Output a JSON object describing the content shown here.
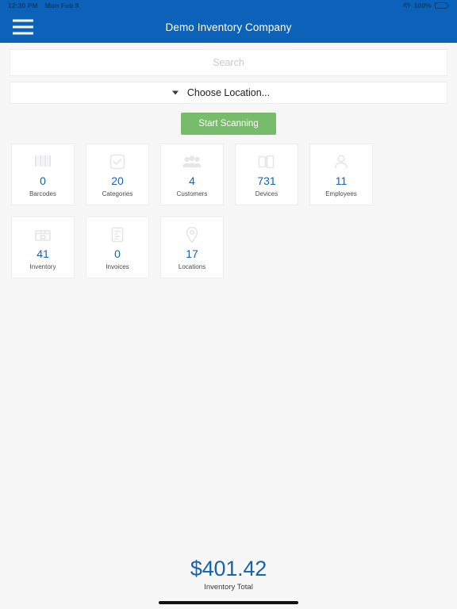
{
  "status_bar": {
    "time": "12:30 PM",
    "date": "Mon Feb 8",
    "battery_percent": "100%",
    "wifi_icon": "wifi-icon",
    "battery_icon": "battery-icon"
  },
  "navbar": {
    "menu_icon": "hamburger-menu-icon",
    "title": "Demo Inventory Company"
  },
  "search": {
    "value": "",
    "placeholder": "Search"
  },
  "location": {
    "label": "Choose Location...",
    "caret_icon": "chevron-down-icon"
  },
  "scan": {
    "label": "Start Scanning",
    "color": "#77bc6a"
  },
  "cards": [
    {
      "value": "0",
      "label": "Barcodes",
      "icon": "barcode-icon"
    },
    {
      "value": "20",
      "label": "Categories",
      "icon": "checkbox-icon"
    },
    {
      "value": "4",
      "label": "Customers",
      "icon": "customers-icon"
    },
    {
      "value": "731",
      "label": "Devices",
      "icon": "devices-icon"
    },
    {
      "value": "11",
      "label": "Employees",
      "icon": "person-icon"
    },
    {
      "value": "41",
      "label": "Inventory",
      "icon": "box-icon"
    },
    {
      "value": "0",
      "label": "Invoices",
      "icon": "invoice-icon"
    },
    {
      "value": "17",
      "label": "Locations",
      "icon": "map-pin-icon"
    }
  ],
  "total": {
    "value": "$401.42",
    "label": "Inventory Total"
  },
  "colors": {
    "brand_blue": "#0c62b8",
    "accent_blue": "#1663ae",
    "green": "#77bc6a",
    "background": "#f7f7f8",
    "icon_gray": "#e3e3e5"
  }
}
